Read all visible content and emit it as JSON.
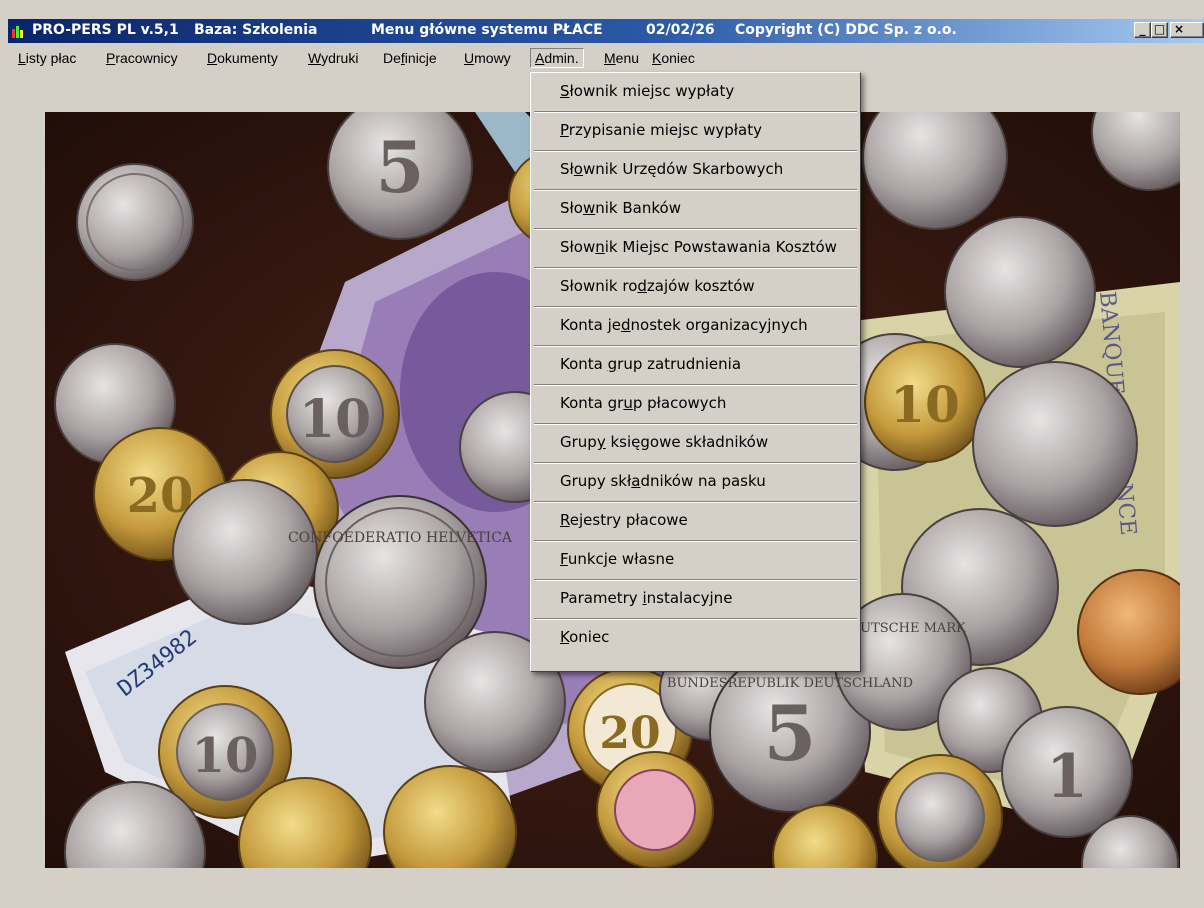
{
  "titlebar": {
    "app": "PRO-PERS PL v.5,1",
    "database": "Baza: Szkolenia",
    "subtitle": "Menu główne systemu PŁACE",
    "date": "02/02/26",
    "copyright": "Copyright (C) DDC Sp. z o.o.",
    "minimize_label": "_",
    "maximize_label": "□",
    "close_label": "×"
  },
  "menubar": {
    "items": [
      {
        "pre": "",
        "key": "L",
        "post": "isty płac"
      },
      {
        "pre": "",
        "key": "P",
        "post": "racownicy"
      },
      {
        "pre": "",
        "key": "D",
        "post": "okumenty"
      },
      {
        "pre": "",
        "key": "W",
        "post": "ydruki"
      },
      {
        "pre": "De",
        "key": "f",
        "post": "inicje"
      },
      {
        "pre": "",
        "key": "U",
        "post": "mowy"
      },
      {
        "pre": "",
        "key": "A",
        "post": "dmin."
      },
      {
        "pre": "",
        "key": "M",
        "post": "enu"
      },
      {
        "pre": "",
        "key": "K",
        "post": "oniec"
      }
    ],
    "active_index": 6
  },
  "dropdown": {
    "items": [
      {
        "pre": "",
        "key": "S",
        "post": "łownik miejsc wypłaty"
      },
      {
        "pre": "",
        "key": "P",
        "post": "rzypisanie miejsc wypłaty"
      },
      {
        "pre": "Sł",
        "key": "o",
        "post": "wnik Urzędów Skarbowych"
      },
      {
        "pre": "Sło",
        "key": "w",
        "post": "nik Banków"
      },
      {
        "pre": "Słow",
        "key": "n",
        "post": "ik Miejsc Powstawania Kosztów"
      },
      {
        "pre": "Słownik ro",
        "key": "d",
        "post": "zajów kosztów"
      },
      {
        "pre": "Konta je",
        "key": "d",
        "post": "nostek organizacyjnych"
      },
      {
        "pre": "Konta ",
        "key": "g",
        "post": "rup zatrudnienia"
      },
      {
        "pre": "Konta gr",
        "key": "u",
        "post": "p płacowych"
      },
      {
        "pre": "Grup",
        "key": "y",
        "post": " księgowe składników"
      },
      {
        "pre": "Grupy skł",
        "key": "a",
        "post": "dników na pasku"
      },
      {
        "pre": "",
        "key": "R",
        "post": "ejestry płacowe"
      },
      {
        "pre": "",
        "key": "F",
        "post": "unkcje własne"
      },
      {
        "pre": "Parametry ",
        "key": "i",
        "post": "nstalacyjne"
      },
      {
        "pre": "",
        "key": "K",
        "post": "oniec"
      }
    ]
  },
  "background": {
    "icon": "coins-and-banknotes-image",
    "banknote_serial": "DZ34982",
    "banknote_text": "BANQUE de FRANCE",
    "coin_texts": [
      "CONFOEDERATIO HELVETICA",
      "BUNDESREPUBLIK DEUTSCHLAND",
      "DEUTSCHE MARK"
    ]
  },
  "colors": {
    "title_start": "#0a246a",
    "title_end": "#a6caf0",
    "face": "#d4d0c8",
    "background_wood": "#3a1c14"
  }
}
